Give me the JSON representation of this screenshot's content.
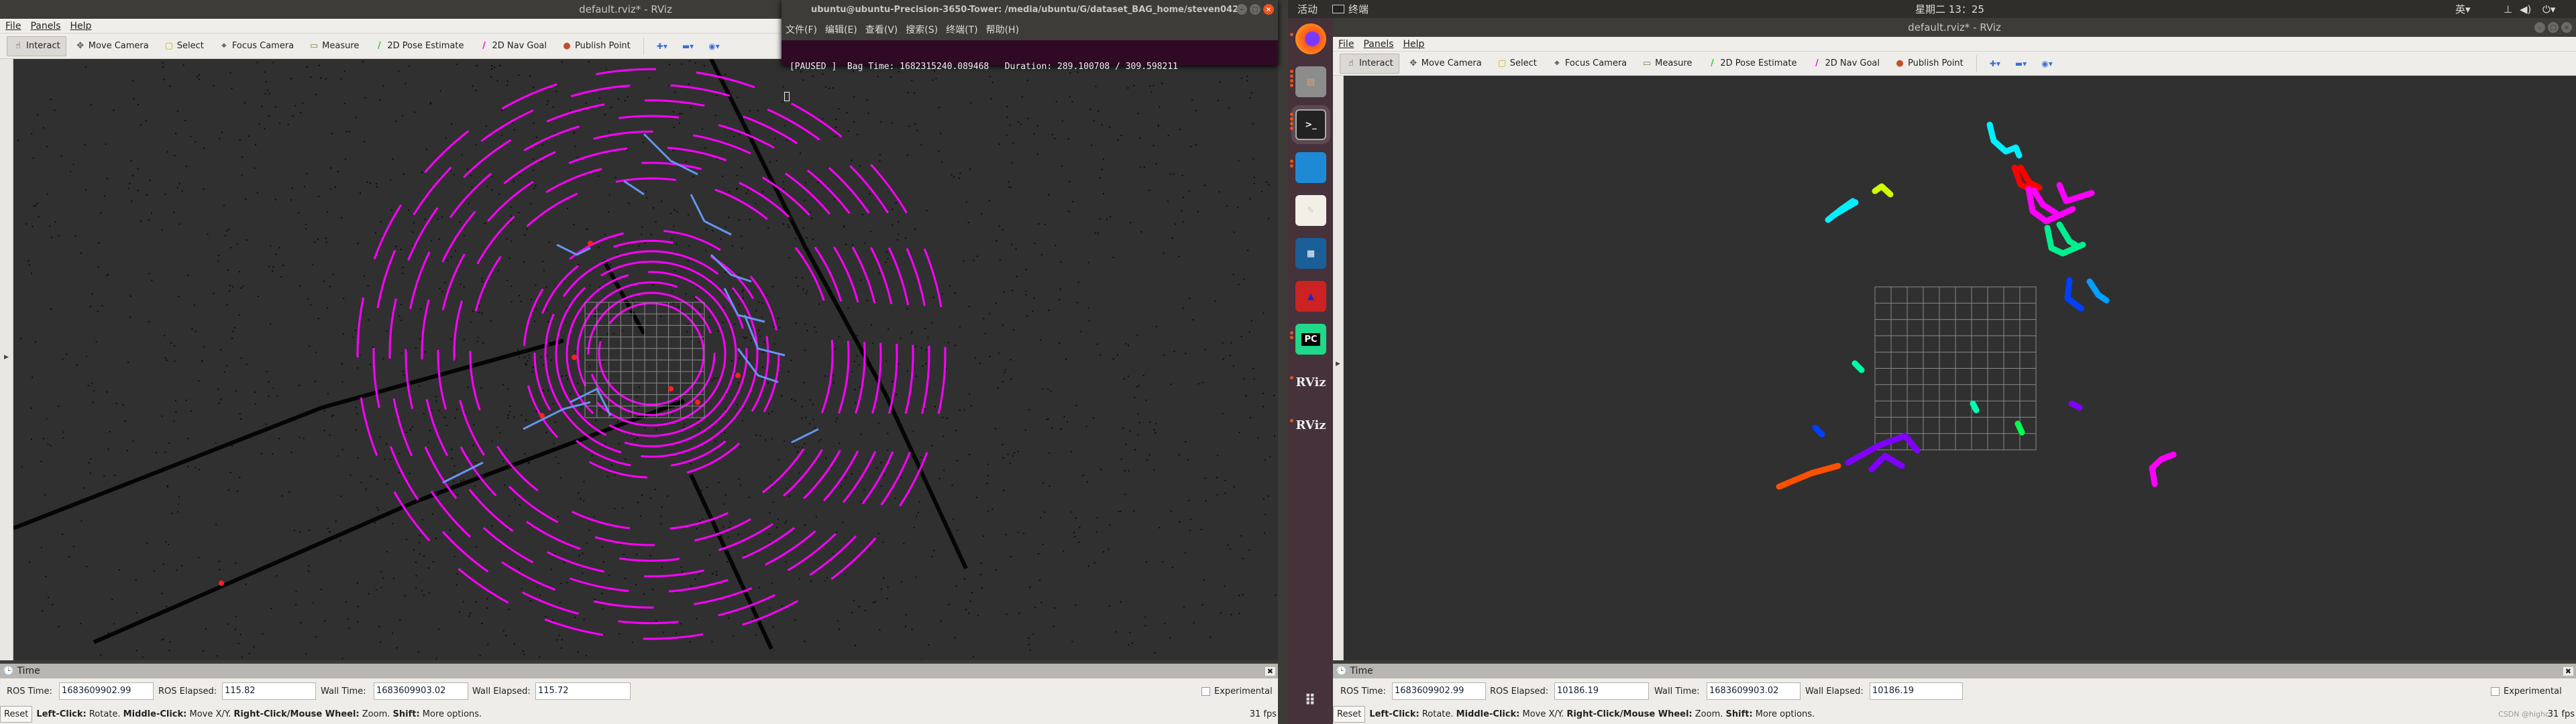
{
  "topbar": {
    "activities": "活动",
    "app_indicator": "终端",
    "clock": "星期二 13：25",
    "input_method": "英▾"
  },
  "left_window": {
    "title": "default.rviz* - RViz",
    "menu": [
      "File",
      "Panels",
      "Help"
    ],
    "toolbar": [
      {
        "label": "Interact",
        "icon": "hand-icon",
        "active": true
      },
      {
        "label": "Move Camera",
        "icon": "move-camera-icon"
      },
      {
        "label": "Select",
        "icon": "select-icon"
      },
      {
        "label": "Focus Camera",
        "icon": "focus-camera-icon"
      },
      {
        "label": "Measure",
        "icon": "ruler-icon"
      },
      {
        "label": "2D Pose Estimate",
        "icon": "green-arrow-icon"
      },
      {
        "label": "2D Nav Goal",
        "icon": "magenta-arrow-icon"
      },
      {
        "label": "Publish Point",
        "icon": "map-pin-icon"
      }
    ],
    "time_panel": {
      "title": "Time",
      "ros_time_label": "ROS Time:",
      "ros_time": "1683609902.99",
      "ros_elapsed_label": "ROS Elapsed:",
      "ros_elapsed": "115.82",
      "wall_time_label": "Wall Time:",
      "wall_time": "1683609903.02",
      "wall_elapsed_label": "Wall Elapsed:",
      "wall_elapsed": "115.72",
      "experimental": "Experimental"
    },
    "status": {
      "reset": "Reset",
      "hint_k1": "Left-Click:",
      "hint_v1": " Rotate. ",
      "hint_k2": "Middle-Click:",
      "hint_v2": " Move X/Y. ",
      "hint_k3": "Right-Click/Mouse Wheel:",
      "hint_v3": " Zoom. ",
      "hint_k4": "Shift:",
      "hint_v4": " More options.",
      "fps": "31 fps"
    }
  },
  "right_window": {
    "title": "default.rviz* - RViz",
    "menu": [
      "File",
      "Panels",
      "Help"
    ],
    "toolbar": [
      {
        "label": "Interact",
        "icon": "hand-icon",
        "active": true
      },
      {
        "label": "Move Camera",
        "icon": "move-camera-icon"
      },
      {
        "label": "Select",
        "icon": "select-icon"
      },
      {
        "label": "Focus Camera",
        "icon": "focus-camera-icon"
      },
      {
        "label": "Measure",
        "icon": "ruler-icon"
      },
      {
        "label": "2D Pose Estimate",
        "icon": "green-arrow-icon"
      },
      {
        "label": "2D Nav Goal",
        "icon": "magenta-arrow-icon"
      },
      {
        "label": "Publish Point",
        "icon": "map-pin-icon"
      }
    ],
    "time_panel": {
      "title": "Time",
      "ros_time_label": "ROS Time:",
      "ros_time": "1683609902.99",
      "ros_elapsed_label": "ROS Elapsed:",
      "ros_elapsed": "10186.19",
      "wall_time_label": "Wall Time:",
      "wall_time": "1683609903.02",
      "wall_elapsed_label": "Wall Elapsed:",
      "wall_elapsed": "10186.19",
      "experimental": "Experimental"
    },
    "status": {
      "reset": "Reset",
      "hint_k1": "Left-Click:",
      "hint_v1": " Rotate. ",
      "hint_k2": "Middle-Click:",
      "hint_v2": " Move X/Y. ",
      "hint_k3": "Right-Click/Mouse Wheel:",
      "hint_v3": " Zoom. ",
      "hint_k4": "Shift:",
      "hint_v4": " More options.",
      "fps": "31 fps",
      "watermark": "CSDN @highc"
    }
  },
  "terminal": {
    "title": "ubuntu@ubuntu-Precision-3650-Tower: /media/ubuntu/G/dataset_BAG_home/steven0424",
    "menu": [
      "文件(F)",
      "编辑(E)",
      "查看(V)",
      "搜索(S)",
      "终端(T)",
      "帮助(H)"
    ],
    "line": " [PAUSED ]  Bag Time: 1682315240.089468   Duration: 289.100708 / 309.598211"
  },
  "dock": {
    "icons": [
      "firefox-icon",
      "files-icon",
      "terminal-icon",
      "vscode-icon",
      "text-editor-icon",
      "libreoffice-writer-icon",
      "cmake-icon",
      "pycharm-icon",
      "rviz-icon",
      "rviz-icon",
      "show-apps-icon"
    ],
    "pycharm_label": "PC",
    "rviz_label": "RViz"
  },
  "colors": {
    "viewport_bg": "#303030",
    "ring": "#ff00ff",
    "obstacle": "#6495ed",
    "accent": "#e95420",
    "terminal_bg": "#300a24"
  }
}
